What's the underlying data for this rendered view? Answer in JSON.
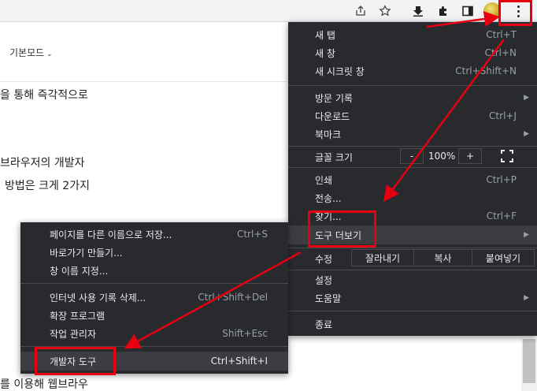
{
  "page": {
    "mode_label": "기본모드",
    "lines": [
      "을 통해 즉각적으로",
      "브라우저의 개발자",
      "방법은 크게 2가지",
      "를 이용해 웹브라우"
    ]
  },
  "toolbar": {
    "icons": [
      "share-icon",
      "star-icon",
      "download-icon",
      "extensions-icon",
      "sidepanel-icon",
      "profile-avatar",
      "kebab-menu-icon"
    ]
  },
  "menu": {
    "new_tab": {
      "label": "새 탭",
      "shortcut": "Ctrl+T"
    },
    "new_window": {
      "label": "새 창",
      "shortcut": "Ctrl+N"
    },
    "incognito": {
      "label": "새 시크릿 창",
      "shortcut": "Ctrl+Shift+N"
    },
    "history": {
      "label": "방문 기록"
    },
    "downloads": {
      "label": "다운로드",
      "shortcut": "Ctrl+J"
    },
    "bookmarks": {
      "label": "북마크"
    },
    "zoom": {
      "label": "글꼴 크기",
      "minus": "-",
      "value": "100%",
      "plus": "+"
    },
    "print": {
      "label": "인쇄",
      "shortcut": "Ctrl+P"
    },
    "cast": {
      "label": "전송..."
    },
    "find": {
      "label": "찾기...",
      "shortcut": "Ctrl+F"
    },
    "more_tools": {
      "label": "도구 더보기"
    },
    "edit": {
      "label": "수정",
      "cut": "잘라내기",
      "copy": "복사",
      "paste": "붙여넣기"
    },
    "settings": {
      "label": "설정"
    },
    "help": {
      "label": "도움말"
    },
    "exit": {
      "label": "종료"
    }
  },
  "submenu": {
    "save_page": {
      "label": "페이지를 다른 이름으로 저장...",
      "shortcut": "Ctrl+S"
    },
    "create_shortcut": {
      "label": "바로가기 만들기..."
    },
    "name_window": {
      "label": "창 이름 지정..."
    },
    "clear_data": {
      "label": "인터넷 사용 기록 삭제...",
      "shortcut": "Ctrl+Shift+Del"
    },
    "extensions": {
      "label": "확장 프로그램"
    },
    "task_manager": {
      "label": "작업 관리자",
      "shortcut": "Shift+Esc"
    },
    "dev_tools": {
      "label": "개발자 도구",
      "shortcut": "Ctrl+Shift+I"
    }
  },
  "colors": {
    "menu_bg": "#292a2d",
    "menu_text": "#e8eaed",
    "annotation": "#e60012"
  }
}
